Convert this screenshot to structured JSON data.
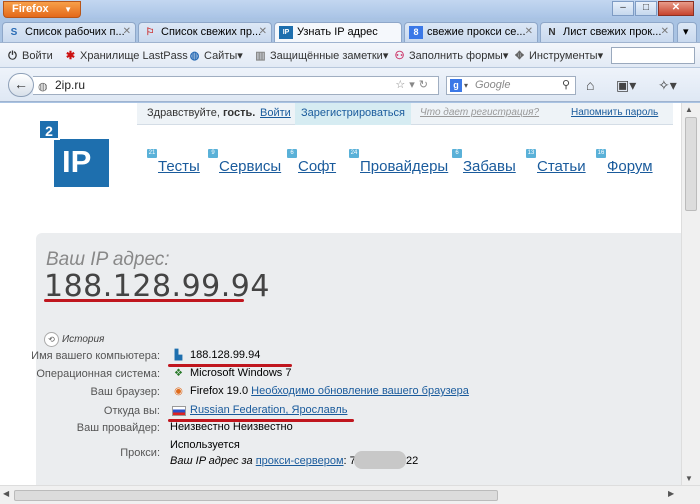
{
  "window": {
    "app_button": "Firefox",
    "controls": {
      "minimize": "–",
      "maximize": "□",
      "close": "✕"
    }
  },
  "tabs": [
    {
      "label": "Список рабочих п...",
      "icon": "S",
      "active": false
    },
    {
      "label": "Список свежих пр...",
      "icon": "⚐",
      "active": false
    },
    {
      "label": "Узнать IP адрес",
      "icon": "IP",
      "active": true
    },
    {
      "label": "свежие прокси се...",
      "icon": "8",
      "active": false
    },
    {
      "label": "Лист свежих прок...",
      "icon": "N",
      "active": false
    }
  ],
  "bookmarks": {
    "login": "Войти",
    "lastpass": "Хранилище LastPass",
    "sites": "Сайты",
    "notes": "Защищённые заметки",
    "fill": "Заполнить формы",
    "tools": "Инструменты"
  },
  "nav": {
    "url": "2ip.ru",
    "search_placeholder": "Google"
  },
  "site": {
    "greeting_prefix": "Здравствуйте,",
    "greeting_user": "гость.",
    "login": "Войти",
    "register": "Зарегистрироваться",
    "what_register": "Что дает регистрация?",
    "remind_password": "Напомнить пароль",
    "logo_small": "2",
    "logo_main": "IP",
    "menu": [
      {
        "label": "Тесты",
        "badge": "21"
      },
      {
        "label": "Сервисы",
        "badge": "9"
      },
      {
        "label": "Софт",
        "badge": "6"
      },
      {
        "label": "Провайдеры",
        "badge": "24"
      },
      {
        "label": "Забавы",
        "badge": "6"
      },
      {
        "label": "Статьи",
        "badge": "13"
      },
      {
        "label": "Форум",
        "badge": "16"
      }
    ]
  },
  "ip_info": {
    "title": "Ваш IP адрес:",
    "ip": "188.128.99.94",
    "history": "История",
    "rows": {
      "computer_label": "Имя вашего компьютера:",
      "computer_value": "188.128.99.94",
      "os_label": "Операционная система:",
      "os_value": "Microsoft Windows 7",
      "browser_label": "Ваш браузер:",
      "browser_value": "Firefox 19.0",
      "browser_link": "Необходимо обновление вашего браузера",
      "location_label": "Откуда вы:",
      "location_value": "Russian Federation, Ярославль",
      "provider_label": "Ваш провайдер:",
      "provider_value": "Неизвестно Неизвестно",
      "proxy_label": "Прокси:",
      "proxy_status": "Используется",
      "proxy_text": "Ваш IP адрес за",
      "proxy_link": "прокси-сервером",
      "proxy_ip_start": ": 7",
      "proxy_ip_end": "22"
    }
  },
  "colors": {
    "accent": "#1e6fae",
    "underline_red": "#c0161e",
    "link": "#1a5b9c"
  }
}
